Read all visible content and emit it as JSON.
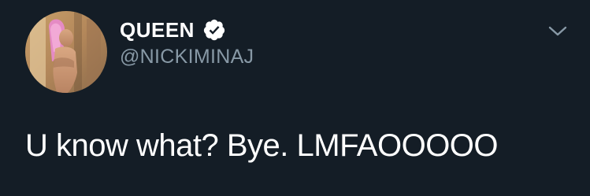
{
  "tweet": {
    "display_name": "QUEEN",
    "handle": "@NICKIMINAJ",
    "text": "U know what? Bye. LMFAOOOOO",
    "verified": true
  },
  "icons": {
    "verified": "verified-badge-icon",
    "menu": "chevron-down-icon"
  },
  "colors": {
    "background": "#141d26",
    "handle": "#8899a6",
    "text": "#ffffff"
  }
}
